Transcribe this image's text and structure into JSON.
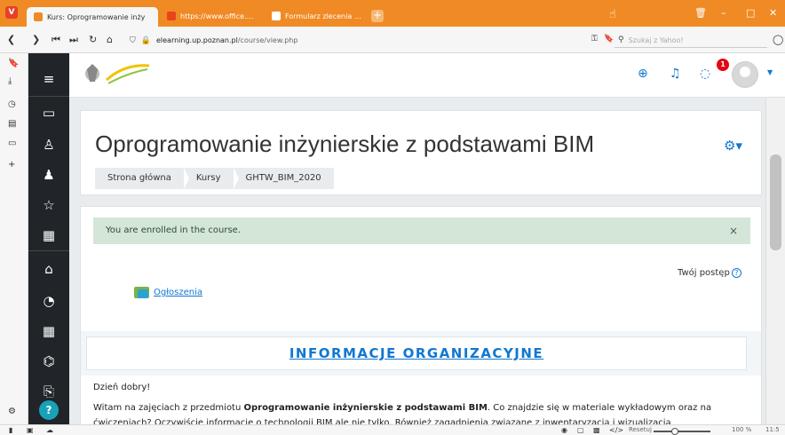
{
  "browser": {
    "tabs": [
      {
        "label": "Kurs: Oprogramowanie inży",
        "active": true
      },
      {
        "label": "https://www.office.com/?a",
        "active": false
      },
      {
        "label": "Formularz zlecenia \"utworz",
        "active": false
      }
    ],
    "new_tab_symbol": "+",
    "url_host": "elearning.up.poznan.pl",
    "url_path": "/course/view.php",
    "search_placeholder": "Szukaj z Yahoo!",
    "zoom_reset_label": "Resetuj",
    "zoom_level": "100 %",
    "clock": "11:5"
  },
  "navbar": {
    "notification_count": "1"
  },
  "course": {
    "title": "Oprogramowanie inżynierskie z podstawami BIM",
    "breadcrumb": [
      "Strona główna",
      "Kursy",
      "GHTW_BIM_2020"
    ],
    "alert_text": "You are enrolled in the course.",
    "alert_close": "×",
    "progress_label": "Twój postęp",
    "progress_help": "?",
    "forum_link": "Ogłoszenia",
    "info_heading": "INFORMACJE ORGANIZACYJNE",
    "greeting": "Dzień dobry!",
    "para_part1": "Witam na zajęciach z przedmiotu ",
    "para_bold": "Oprogramowanie inżynierskie z podstawami BIM",
    "para_part2": ". Co znajdzie się w materiale wykładowym oraz na ćwiczeniach? Oczywiście informacje o technologii BIM ale nie tylko. Również zagadnienia związane z inwentaryzacją i wizualizacją"
  },
  "colors": {
    "tabbar": "#f08a24",
    "drawer": "#212529",
    "link": "#1177d1",
    "alert_bg": "#d4e6d8",
    "badge": "#e30613"
  },
  "icons": {
    "drawer": [
      "hamburger-icon",
      "folder-icon",
      "users-icon",
      "user-group-icon",
      "star-icon",
      "book-icon",
      "home-icon",
      "dashboard-icon",
      "calendar-icon",
      "graduation-icon",
      "file-icon",
      "help-icon"
    ]
  }
}
